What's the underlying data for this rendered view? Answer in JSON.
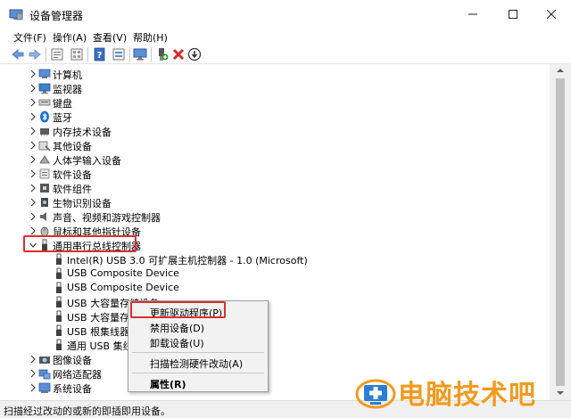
{
  "window": {
    "title": "设备管理器",
    "controls": {
      "minimize": "—",
      "maximize": "☐",
      "close": "✕"
    }
  },
  "menubar": [
    {
      "label": "文件(F)"
    },
    {
      "label": "操作(A)"
    },
    {
      "label": "查看(V)"
    },
    {
      "label": "帮助(H)"
    }
  ],
  "toolbar": {
    "icons": [
      "back-arrow-icon",
      "forward-arrow-icon",
      "properties-icon",
      "details-icon",
      "help-icon",
      "scan-icon",
      "monitor-icon",
      "add-driver-icon",
      "remove-icon",
      "download-icon"
    ]
  },
  "tree": {
    "items": [
      {
        "label": "计算机",
        "expanded": false,
        "level": 0,
        "icon": "computer-icon"
      },
      {
        "label": "监视器",
        "expanded": false,
        "level": 0,
        "icon": "monitor-icon"
      },
      {
        "label": "键盘",
        "expanded": false,
        "level": 0,
        "icon": "keyboard-icon"
      },
      {
        "label": "蓝牙",
        "expanded": false,
        "level": 0,
        "icon": "bluetooth-icon"
      },
      {
        "label": "内存技术设备",
        "expanded": false,
        "level": 0,
        "icon": "memory-icon"
      },
      {
        "label": "其他设备",
        "expanded": false,
        "level": 0,
        "icon": "other-device-icon"
      },
      {
        "label": "人体学输入设备",
        "expanded": false,
        "level": 0,
        "icon": "hid-icon"
      },
      {
        "label": "软件设备",
        "expanded": false,
        "level": 0,
        "icon": "software-device-icon"
      },
      {
        "label": "软件组件",
        "expanded": false,
        "level": 0,
        "icon": "software-component-icon"
      },
      {
        "label": "生物识别设备",
        "expanded": false,
        "level": 0,
        "icon": "biometric-icon"
      },
      {
        "label": "声音、视频和游戏控制器",
        "expanded": false,
        "level": 0,
        "icon": "audio-icon"
      },
      {
        "label": "鼠标和其他指针设备",
        "expanded": false,
        "level": 0,
        "icon": "mouse-icon"
      },
      {
        "label": "通用串行总线控制器",
        "expanded": true,
        "level": 0,
        "icon": "usb-icon"
      },
      {
        "label": "Intel(R) USB 3.0 可扩展主机控制器 - 1.0 (Microsoft)",
        "level": 1,
        "icon": "usb-icon"
      },
      {
        "label": "USB Composite Device",
        "level": 1,
        "icon": "usb-icon"
      },
      {
        "label": "USB Composite Device",
        "level": 1,
        "icon": "usb-icon"
      },
      {
        "label": "USB 大容量存储设备",
        "level": 1,
        "icon": "usb-icon"
      },
      {
        "label": "USB 大容量存储设备",
        "level": 1,
        "icon": "usb-icon"
      },
      {
        "label": "USB 根集线器(USB 3.0)",
        "level": 1,
        "icon": "usb-icon"
      },
      {
        "label": "通用 USB 集线器",
        "level": 1,
        "icon": "usb-icon"
      },
      {
        "label": "图像设备",
        "expanded": false,
        "level": 0,
        "icon": "camera-icon"
      },
      {
        "label": "网络适配器",
        "expanded": false,
        "level": 0,
        "icon": "network-icon"
      },
      {
        "label": "系统设备",
        "expanded": false,
        "level": 0,
        "icon": "system-icon"
      }
    ]
  },
  "context_menu": {
    "items": [
      {
        "label": "更新驱动程序(P)",
        "bold": false
      },
      {
        "label": "禁用设备(D)",
        "bold": false
      },
      {
        "label": "卸载设备(U)",
        "bold": false
      },
      {
        "label": "扫描检测硬件改动(A)",
        "bold": false
      },
      {
        "label": "属性(R)",
        "bold": true
      }
    ]
  },
  "statusbar": {
    "text": "扫描经过改动的或新的即插即用设备。"
  },
  "watermark": {
    "text": "电脑技术吧"
  },
  "colors": {
    "highlight_box": "#d9302c",
    "watermark": "#f29a1f",
    "usb_icon": "#404040"
  }
}
